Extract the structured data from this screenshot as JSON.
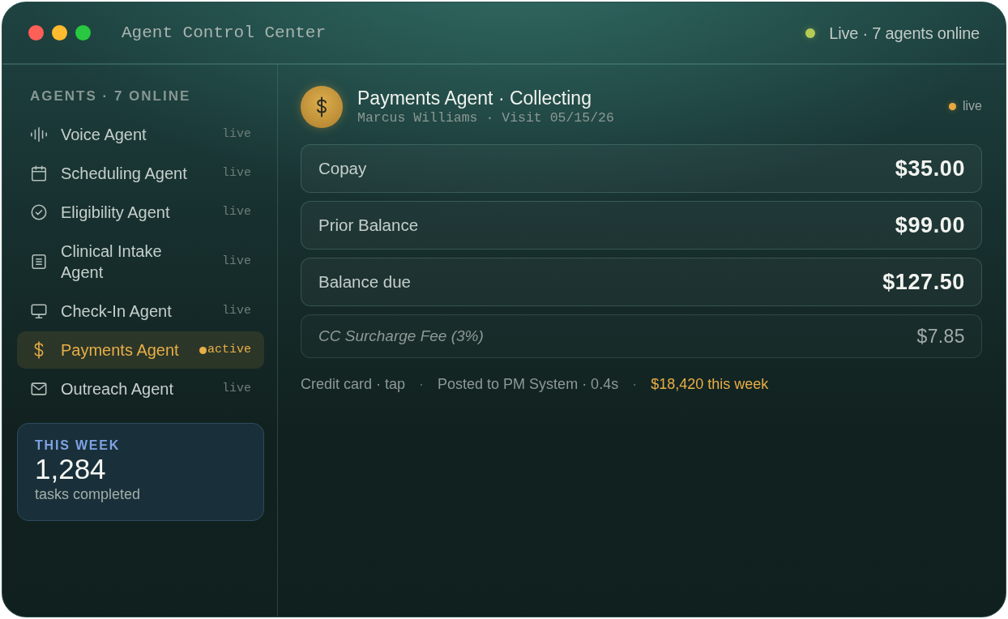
{
  "window": {
    "title": "Agent Control Center",
    "status": "Live · 7 agents online"
  },
  "sidebar": {
    "heading": "AGENTS · 7 ONLINE",
    "items": [
      {
        "label": "Voice Agent",
        "status": "live",
        "selected": false
      },
      {
        "label": "Scheduling Agent",
        "status": "live",
        "selected": false
      },
      {
        "label": "Eligibility Agent",
        "status": "live",
        "selected": false
      },
      {
        "label": "Clinical Intake Agent",
        "status": "live",
        "selected": false
      },
      {
        "label": "Check-In Agent",
        "status": "live",
        "selected": false
      },
      {
        "label": "Payments Agent",
        "status": "active",
        "selected": true
      },
      {
        "label": "Outreach Agent",
        "status": "live",
        "selected": false
      }
    ],
    "stats": {
      "label": "THIS WEEK",
      "value": "1,284",
      "caption": "tasks completed"
    }
  },
  "detail": {
    "title": "Payments Agent · Collecting",
    "subtitle": "Marcus Williams · Visit 05/15/26",
    "status": "live",
    "line_items": [
      {
        "kind": "charge",
        "label": "Copay",
        "amount": "$35.00"
      },
      {
        "kind": "charge",
        "label": "Prior Balance",
        "amount": "$99.00"
      },
      {
        "kind": "charge",
        "label": "Balance due",
        "amount": "$127.50"
      },
      {
        "kind": "fee",
        "label": "CC Surcharge Fee (3%)",
        "amount": "$7.85"
      }
    ],
    "footer": [
      {
        "kind": "detail",
        "text": "Credit card · tap"
      },
      {
        "kind": "separator",
        "text": "·"
      },
      {
        "kind": "detail",
        "text": "Posted to PM System · 0.4s"
      },
      {
        "kind": "separator",
        "text": "·"
      },
      {
        "kind": "total",
        "text": "$18,420 this week"
      }
    ]
  }
}
